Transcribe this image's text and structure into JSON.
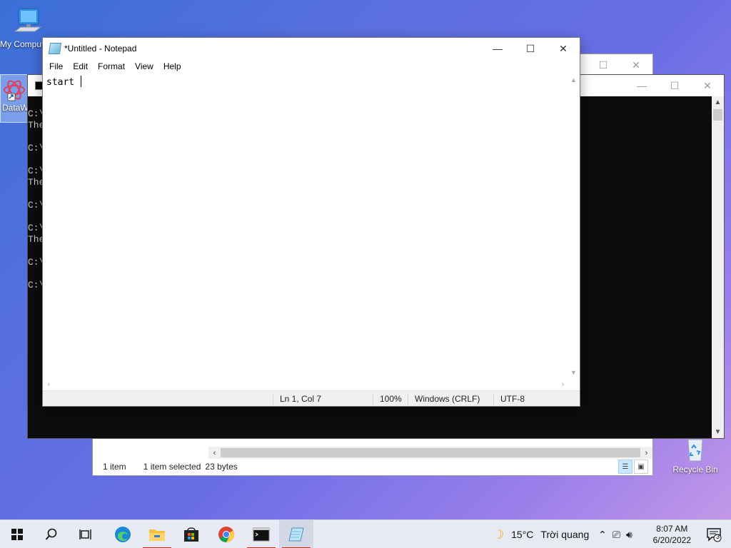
{
  "desktop": {
    "icons": [
      {
        "label": "My Computer"
      },
      {
        "label": "DataW"
      },
      {
        "label": "Recycle Bin"
      }
    ]
  },
  "explorer": {
    "status": {
      "item_count": "1 item",
      "selected": "1 item selected",
      "size": "23 bytes"
    }
  },
  "cmd": {
    "lines": "C:\\\nThe\n\nC:\\\n\nC:\\\nThe\n\nC:\\\n\nC:\\\nThe\n\nC:\\\n\nC:\\"
  },
  "notepad": {
    "title": "*Untitled - Notepad",
    "menu": [
      "File",
      "Edit",
      "Format",
      "View",
      "Help"
    ],
    "content": "start ",
    "status": {
      "position": "Ln 1, Col 7",
      "zoom": "100%",
      "line_ending": "Windows (CRLF)",
      "encoding": "UTF-8"
    }
  },
  "taskbar": {
    "weather": {
      "temp": "15°C",
      "condition": "Trời quang"
    },
    "clock": {
      "time": "8:07 AM",
      "date": "6/20/2022"
    },
    "notification_count": "3"
  }
}
